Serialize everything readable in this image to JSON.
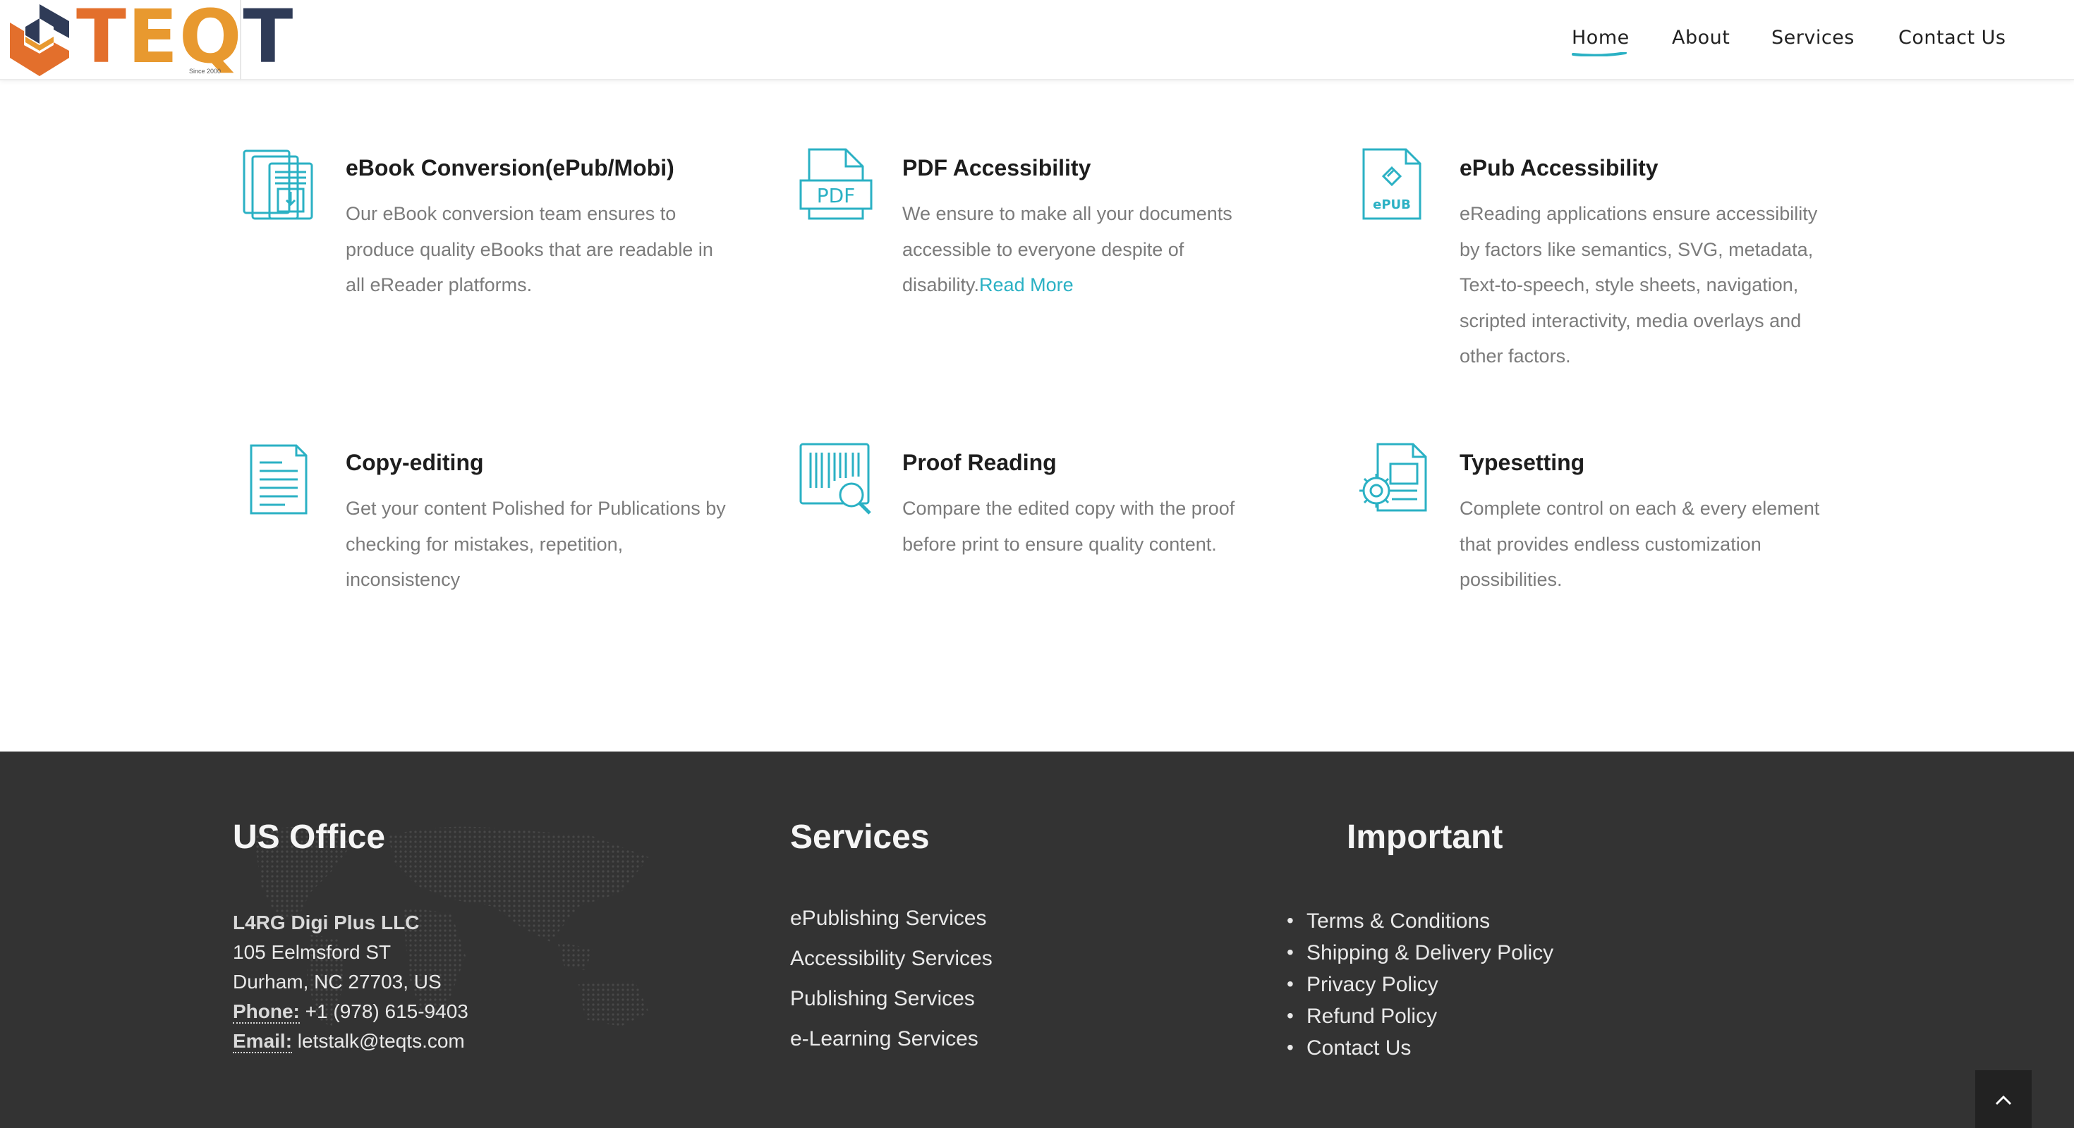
{
  "brand": {
    "logo_text_1": "T",
    "logo_text_2": "E",
    "logo_text_3": "Q",
    "logo_text_4": "T",
    "since": "Since 2000",
    "colors": {
      "orange": "#e36f2c",
      "amber": "#e8992f",
      "navy": "#2f3b57",
      "accent": "#2bb1c4"
    }
  },
  "nav": {
    "items": [
      {
        "label": "Home",
        "active": true
      },
      {
        "label": "About"
      },
      {
        "label": "Services"
      },
      {
        "label": "Contact Us"
      }
    ]
  },
  "services": [
    {
      "icon": "ebook-icon",
      "title": "eBook Conversion(ePub/Mobi)",
      "desc": "Our eBook conversion team ensures to produce quality eBooks that are readable in all eReader platforms."
    },
    {
      "icon": "pdf-icon",
      "title": "PDF Accessibility",
      "desc": "We ensure to make all your documents accessible to everyone despite of disability.",
      "link": "Read More"
    },
    {
      "icon": "epub-icon",
      "title": "ePub Accessibility",
      "desc": "eReading applications ensure accessibility by factors like semantics, SVG, metadata, Text-to-speech, style sheets, navigation, scripted interactivity, media overlays and other factors."
    },
    {
      "icon": "document-icon",
      "title": "Copy-editing",
      "desc": "Get your content Polished for Publications by checking for mistakes, repetition, inconsistency"
    },
    {
      "icon": "barcode-search-icon",
      "title": "Proof Reading",
      "desc": "Compare the edited copy with the proof before print to ensure quality content."
    },
    {
      "icon": "typesetting-gear-icon",
      "title": "Typesetting",
      "desc": "Complete control on each & every element that provides endless customization possibilities."
    }
  ],
  "footer": {
    "office": {
      "heading": "US Office",
      "company": "L4RG Digi Plus LLC",
      "street": "105 Eelmsford ST",
      "city": "Durham, NC 27703, US",
      "phone_label": "Phone:",
      "phone": " +1 (978) 615-9403",
      "email_label": "Email:",
      "email": " letstalk@teqts.com"
    },
    "services": {
      "heading": "Services",
      "links": [
        "ePublishing Services",
        "Accessibility Services",
        "Publishing Services",
        "e-Learning Services"
      ]
    },
    "important": {
      "heading": "Important",
      "links": [
        "Terms & Conditions",
        "Shipping & Delivery Policy",
        "Privacy Policy",
        "Refund Policy",
        "Contact Us"
      ]
    }
  }
}
